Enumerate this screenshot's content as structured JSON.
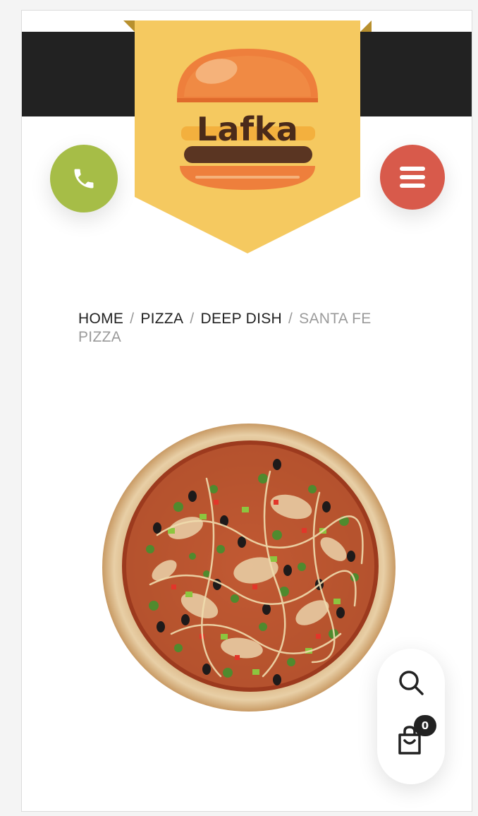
{
  "header": {
    "logo_text": "Lafka",
    "colors": {
      "topbar": "#222222",
      "logo_badge": "#f5c960",
      "phone_button": "#a6bd47",
      "menu_button": "#d85a4b"
    },
    "phone_icon": "phone-icon",
    "menu_icon": "hamburger-menu-icon"
  },
  "breadcrumb": {
    "items": [
      {
        "label": "HOME"
      },
      {
        "label": "PIZZA"
      },
      {
        "label": "DEEP DISH"
      }
    ],
    "separator": "/",
    "current": "SANTA FE PIZZA"
  },
  "product": {
    "image": "santa-fe-pizza-image"
  },
  "floating_actions": {
    "search_icon": "search-icon",
    "cart_icon": "shopping-bag-icon",
    "cart_count": "0"
  }
}
